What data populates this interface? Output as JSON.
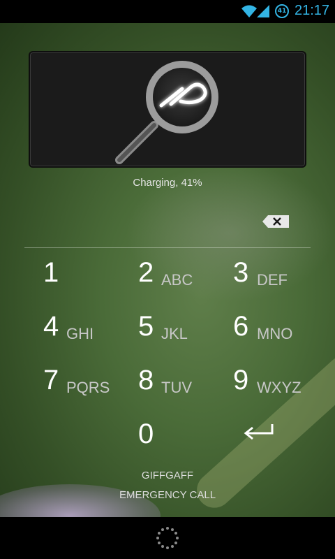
{
  "status_bar": {
    "clock": "21:17",
    "battery_level": "41",
    "accent_color": "#33b5e5",
    "icons": [
      "wifi-icon",
      "signal-icon",
      "battery-icon"
    ]
  },
  "lockscreen": {
    "widget_icon": "search-magnifier-icon",
    "charging_status": "Charging, 41%",
    "carrier": "GIFFGAFF",
    "emergency_call": "EMERGENCY CALL"
  },
  "keypad": {
    "keys": [
      {
        "digit": "1",
        "letters": ""
      },
      {
        "digit": "2",
        "letters": "ABC"
      },
      {
        "digit": "3",
        "letters": "DEF"
      },
      {
        "digit": "4",
        "letters": "GHI"
      },
      {
        "digit": "5",
        "letters": "JKL"
      },
      {
        "digit": "6",
        "letters": "MNO"
      },
      {
        "digit": "7",
        "letters": "PQRS"
      },
      {
        "digit": "8",
        "letters": "TUV"
      },
      {
        "digit": "9",
        "letters": "WXYZ"
      },
      {
        "digit": "0",
        "letters": ""
      }
    ],
    "backspace_icon": "backspace-icon",
    "enter_icon": "enter-arrow-icon"
  }
}
